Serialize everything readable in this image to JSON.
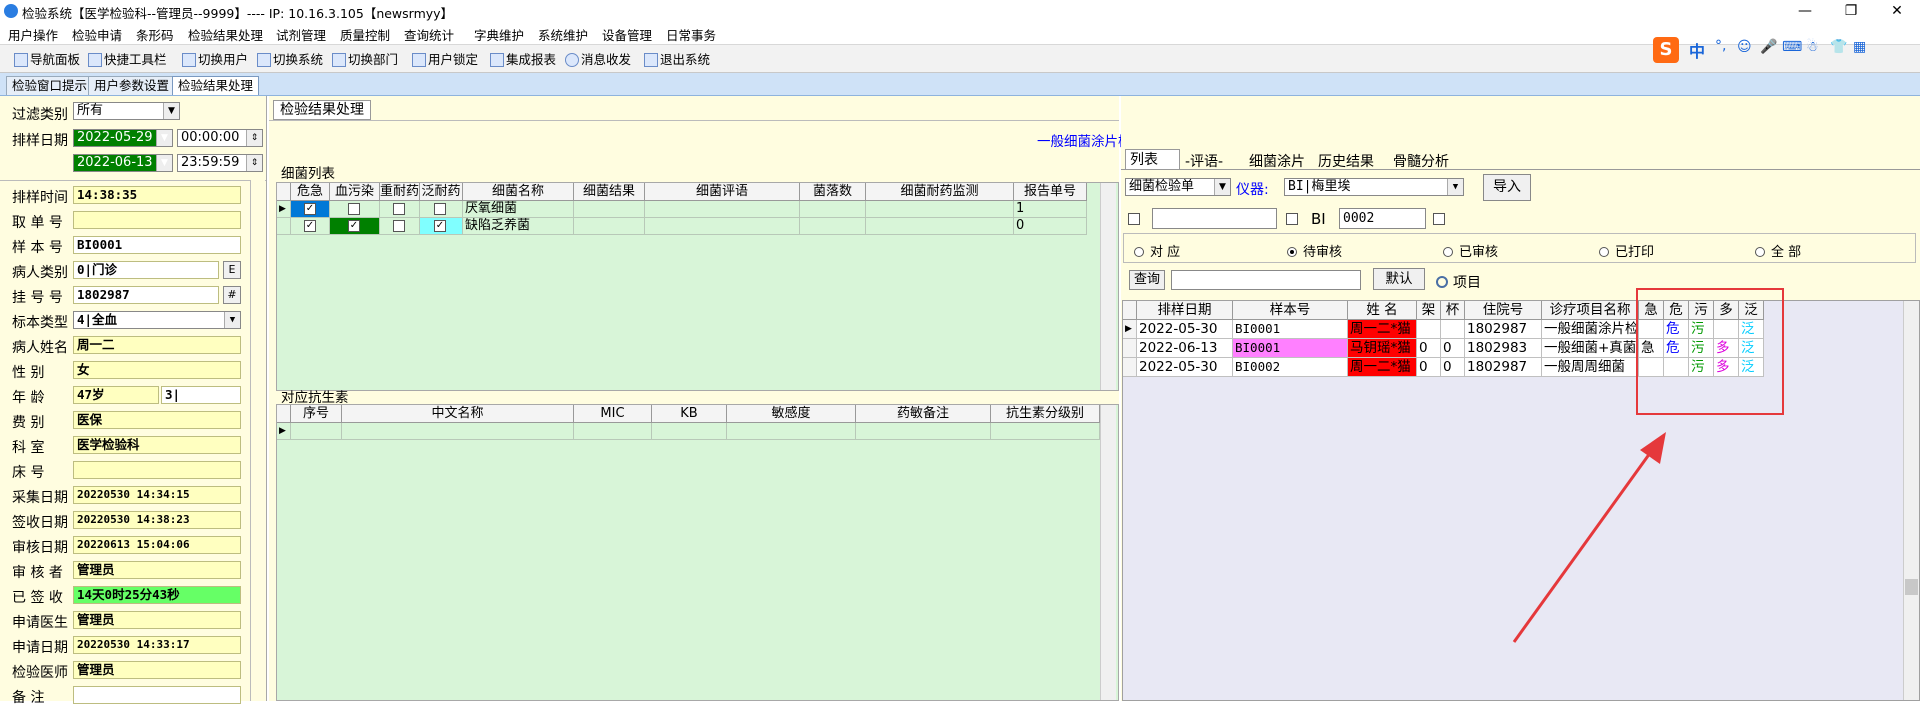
{
  "window": {
    "title": "检验系统【医学检验科--管理员--9999】---- IP: 10.16.3.105【newsrmyy】"
  },
  "menu": [
    "用户操作",
    "检验申请",
    "条形码",
    "检验结果处理",
    "试剂管理",
    "质量控制",
    "查询统计",
    "字典维护",
    "系统维护",
    "设备管理",
    "日常事务"
  ],
  "toolbar": [
    "导航面板",
    "快捷工具栏",
    "切换用户",
    "切换系统",
    "切换部门",
    "用户锁定",
    "集成报表",
    "消息收发",
    "退出系统"
  ],
  "ime": {
    "logo": "S",
    "label": "中"
  },
  "tabs": [
    "检验窗口提示",
    "用户参数设置",
    "检验结果处理"
  ],
  "left": {
    "filter_label": "过滤类别",
    "filter_value": "所有",
    "date_label": "排样日期",
    "date_from": "2022-05-29",
    "time_from": "00:00:00",
    "date_to": "2022-06-13",
    "time_to": "23:59:59",
    "fields": [
      {
        "label": "排样时间",
        "value": "14:38:35"
      },
      {
        "label": "取 单 号",
        "value": ""
      },
      {
        "label": "样 本 号",
        "value": "BI0001"
      },
      {
        "label": "病人类别",
        "value": "0|门诊",
        "btn": "E"
      },
      {
        "label": "挂 号 号",
        "value": "1802987",
        "btn": "#"
      },
      {
        "label": "标本类型",
        "value": "4|全血"
      },
      {
        "label": "病人姓名",
        "value": "周一二"
      },
      {
        "label": "性    别",
        "value": "女"
      },
      {
        "label": "年    龄",
        "value": "47岁",
        "value2": "3|"
      },
      {
        "label": "费    别",
        "value": "医保"
      },
      {
        "label": "科    室",
        "value": "医学检验科"
      },
      {
        "label": "床    号",
        "value": ""
      },
      {
        "label": "采集日期",
        "value": "20220530 14:34:15"
      },
      {
        "label": "签收日期",
        "value": "20220530 14:38:23"
      },
      {
        "label": "审核日期",
        "value": "20220613 15:04:06"
      },
      {
        "label": "审 核 者",
        "value": "管理员"
      },
      {
        "label": "已 签 收",
        "value": "14天0时25分43秒"
      },
      {
        "label": "申请医生",
        "value": "管理员"
      },
      {
        "label": "申请日期",
        "value": "20220530 14:33:17"
      },
      {
        "label": "检验医师",
        "value": "管理员"
      },
      {
        "label": "备    注",
        "value": ""
      }
    ]
  },
  "mid": {
    "tab": "检验结果处理",
    "banner": "一般细菌涂片检查|",
    "bacteria_title": "细菌列表",
    "bacteria_headers": [
      "危急",
      "血污染",
      "重耐药",
      "泛耐药",
      "细菌名称",
      "细菌结果",
      "细菌评语",
      "菌落数",
      "细菌耐药监测",
      "报告单号"
    ],
    "bacteria_rows": [
      {
        "name": "厌氧细菌",
        "report": "1"
      },
      {
        "name": "缺陷乏养菌",
        "report": "0"
      }
    ],
    "antibiotic_title": "对应抗生素",
    "antibiotic_headers": [
      "序号",
      "中文名称",
      "MIC",
      "KB",
      "敏感度",
      "药敏备注",
      "抗生素分级别"
    ]
  },
  "right": {
    "tabs": [
      "列表",
      "-评语-",
      "细菌涂片",
      "历史结果",
      "骨髓分析"
    ],
    "doc_type": "细菌检验单",
    "instrument_label": "仪器:",
    "instrument_value": "BI|梅里埃",
    "import_label": "导入",
    "bi_label": "BI",
    "bi_value": "0002",
    "radios": [
      "对 应",
      "待审核",
      "已审核",
      "已打印",
      "全 部"
    ],
    "query_label": "查询",
    "default_label": "默认",
    "items_label": "项目",
    "headers": [
      "排样日期",
      "样本号",
      "姓 名",
      "架",
      "杯",
      "住院号",
      "诊疗项目名称",
      "急",
      "危",
      "污",
      "多",
      "泛"
    ],
    "rows": [
      {
        "date": "2022-05-30",
        "sample": "BI0001",
        "name": "周一二*猫",
        "rack": "",
        "cup": "",
        "inpatient": "1802987",
        "item": "一般细菌涂片检",
        "urgent": "",
        "crit": "危",
        "contam": "污",
        "multi": "",
        "pan": "泛"
      },
      {
        "date": "2022-06-13",
        "sample": "BI0001",
        "name": "马钥瑶*猫",
        "rack": "0",
        "cup": "0",
        "inpatient": "1802983",
        "item": "一般细菌+真菌",
        "urgent": "急",
        "crit": "危",
        "contam": "污",
        "multi": "多",
        "pan": "泛"
      },
      {
        "date": "2022-05-30",
        "sample": "BI0002",
        "name": "周一二*猫",
        "rack": "0",
        "cup": "0",
        "inpatient": "1802987",
        "item": "一般周周细菌",
        "urgent": "",
        "crit": "",
        "contam": "污",
        "multi": "多",
        "pan": "泛"
      }
    ]
  },
  "colors": {
    "accent_blue": "#0000ff",
    "green": "#009900",
    "magenta": "#dd00dd",
    "cyan": "#00ccff",
    "red": "#ff0000",
    "pink": "#ff80ff",
    "annotation": "#e5383b"
  }
}
